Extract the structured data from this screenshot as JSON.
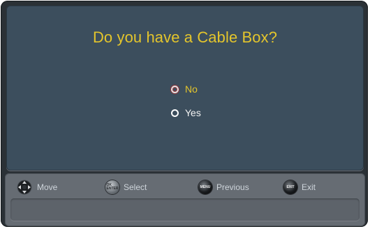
{
  "dialog": {
    "title": "Do you have a Cable Box?",
    "options": [
      {
        "label": "No",
        "selected": true
      },
      {
        "label": "Yes",
        "selected": false
      }
    ]
  },
  "footer": {
    "hints": [
      {
        "icon": "dpad-icon",
        "label": "Move"
      },
      {
        "icon": "ok-enter-button-icon",
        "label": "Select"
      },
      {
        "icon": "menu-button-icon",
        "label": "Previous"
      },
      {
        "icon": "exit-button-icon",
        "label": "Exit"
      }
    ],
    "message": ""
  },
  "colors": {
    "title": "#e4c52c",
    "selected_label": "#e4c52c",
    "unselected_label": "#f3f3f3",
    "panel": "#3c4e5d",
    "footer": "#666c73"
  }
}
